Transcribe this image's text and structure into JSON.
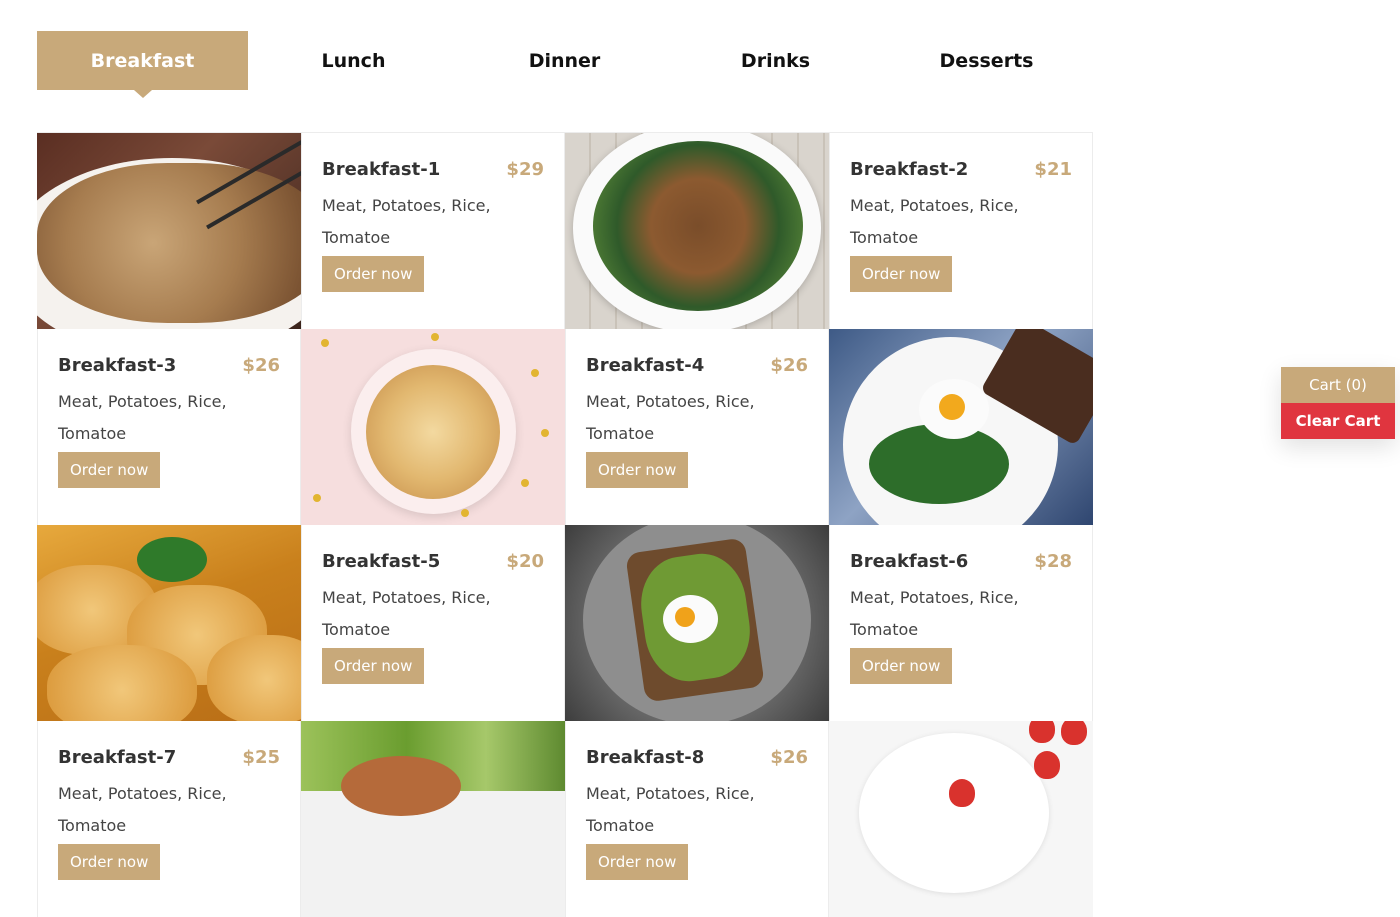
{
  "tabs": [
    {
      "label": "Breakfast",
      "active": true
    },
    {
      "label": "Lunch",
      "active": false
    },
    {
      "label": "Dinner",
      "active": false
    },
    {
      "label": "Drinks",
      "active": false
    },
    {
      "label": "Desserts",
      "active": false
    }
  ],
  "menu_items": [
    {
      "title": "Breakfast-1",
      "price": "$29",
      "description": "Meat, Potatoes, Rice, Tomatoe",
      "order_label": "Order now"
    },
    {
      "title": "Breakfast-2",
      "price": "$21",
      "description": "Meat, Potatoes, Rice, Tomatoe",
      "order_label": "Order now"
    },
    {
      "title": "Breakfast-3",
      "price": "$26",
      "description": "Meat, Potatoes, Rice, Tomatoe",
      "order_label": "Order now"
    },
    {
      "title": "Breakfast-4",
      "price": "$26",
      "description": "Meat, Potatoes, Rice, Tomatoe",
      "order_label": "Order now"
    },
    {
      "title": "Breakfast-5",
      "price": "$20",
      "description": "Meat, Potatoes, Rice, Tomatoe",
      "order_label": "Order now"
    },
    {
      "title": "Breakfast-6",
      "price": "$28",
      "description": "Meat, Potatoes, Rice, Tomatoe",
      "order_label": "Order now"
    },
    {
      "title": "Breakfast-7",
      "price": "$25",
      "description": "Meat, Potatoes, Rice, Tomatoe",
      "order_label": "Order now"
    },
    {
      "title": "Breakfast-8",
      "price": "$26",
      "description": "Meat, Potatoes, Rice, Tomatoe",
      "order_label": "Order now"
    }
  ],
  "cart": {
    "label": "Cart (0)",
    "clear_label": "Clear Cart"
  },
  "colors": {
    "accent": "#c8a97a",
    "danger": "#e0353f"
  }
}
